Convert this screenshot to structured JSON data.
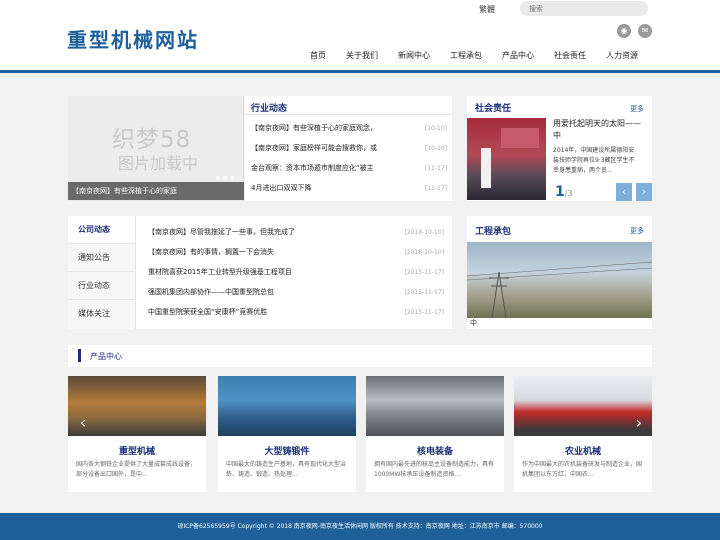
{
  "header": {
    "logo": "重型机械网站",
    "language": "繁體",
    "search_placeholder": "搜索",
    "nav": [
      "首页",
      "关于我们",
      "新闻中心",
      "工程承包",
      "产品中心",
      "社会责任",
      "人力资源"
    ],
    "social_icons": [
      "weibo-icon",
      "wechat-icon"
    ]
  },
  "slider": {
    "watermark_line1": "织梦58",
    "watermark_line2": "图片加载中",
    "caption": "【南京夜网】有些深植于心的家庭"
  },
  "industry": {
    "title": "行业动态",
    "items": [
      {
        "text": "【南京夜网】有些深植于心的家庭观念，",
        "date": "[10-10]"
      },
      {
        "text": "【南京夜网】家庭榜样可能会搜救你，或",
        "date": "[10-10]"
      },
      {
        "text": "金台观察：资本市场遁市制度应化“被主",
        "date": "[11-17]"
      },
      {
        "text": "4月进出口双双下降",
        "date": "[11-17]"
      }
    ]
  },
  "social_resp": {
    "title": "社会责任",
    "more": "更多",
    "headline": "用爱托起明天的太阳——中",
    "description": "2014年，中国建设所属德阳安装技师学院再位9·3藏区学生不幸身患重病，两个员...",
    "page_current": "1",
    "page_total": "/3",
    "prev": "‹",
    "next": "›"
  },
  "company": {
    "tabs": [
      "公司动态",
      "通知公告",
      "行业动态",
      "媒体关注"
    ],
    "items": [
      {
        "text": "【南京夜网】尽管我拖延了一些事，但我完成了",
        "date": "[2018-10-10]"
      },
      {
        "text": "【南京夜网】有的事情，搁置一下会消失",
        "date": "[2018-10-10]"
      },
      {
        "text": "重材院喜获2015年工业转型升级强基工程项目",
        "date": "[2015-11-17]"
      },
      {
        "text": "强国机集团内部协作——中国重型院总包",
        "date": "[2015-11-17]"
      },
      {
        "text": "中国重型院荣获全国“安康杯”竞赛优胜",
        "date": "[2015-11-17]"
      }
    ]
  },
  "engineering": {
    "title": "工程承包",
    "more": "更多",
    "caption": "中"
  },
  "products": {
    "title": "产品中心",
    "prev": "‹",
    "next": "›",
    "items": [
      {
        "name": "重型机械",
        "desc": "国内各大钢铁企业提供了大量成套成线设备，部分设备出口国外，是中..."
      },
      {
        "name": "大型铸锻件",
        "desc": "中国最大的铸造生产基地，具有现代化大型冶炼、铸造、锻造、热处理..."
      },
      {
        "name": "核电装备",
        "desc": "拥有国内最先进的核岛主设备制造能力，具有1000MW核承压设备制造资格..."
      },
      {
        "name": "农业机械",
        "desc": "作为中国最大的农机装备研发与制造企业，国机集团以东方红，中国农..."
      }
    ]
  },
  "footer": {
    "text": "琼ICP备62565959号    Copyright © 2018 南京夜网-南京夜生活休闲网 版权所有 技术支持：南京夜网    地址：江苏南京市 邮编：570000"
  }
}
